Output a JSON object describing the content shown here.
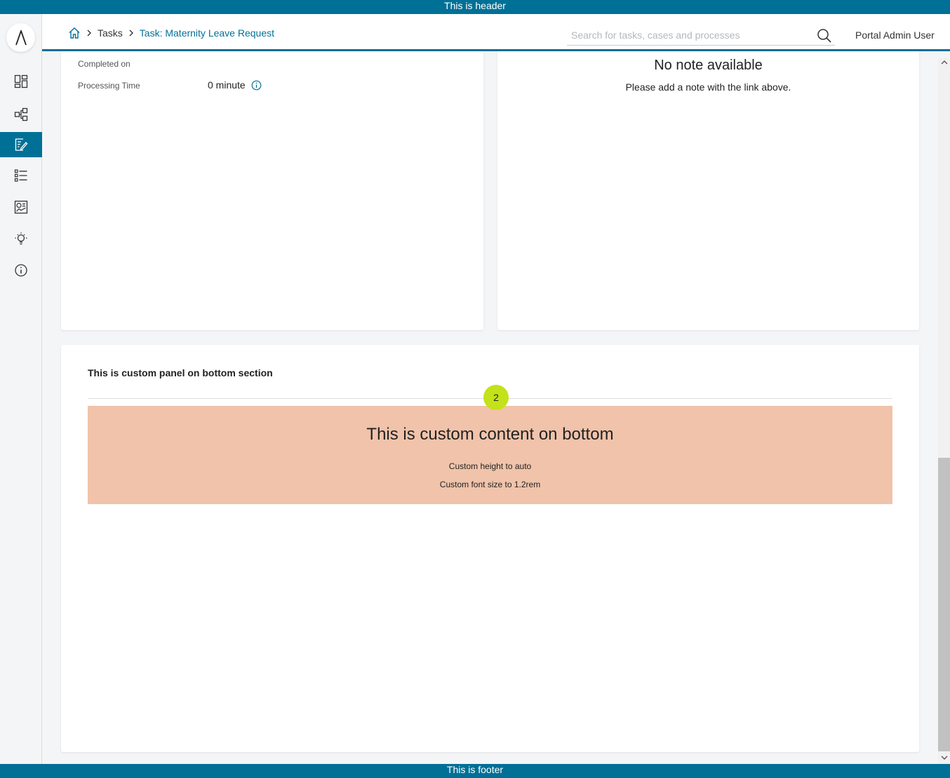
{
  "banners": {
    "header": "This is header",
    "footer": "This is footer"
  },
  "sidebar": {
    "logo": "Λ",
    "items": [
      {
        "name": "dashboard",
        "icon": "dashboard-icon"
      },
      {
        "name": "processes",
        "icon": "process-icon"
      },
      {
        "name": "tasks",
        "icon": "task-edit-icon",
        "active": true
      },
      {
        "name": "cases",
        "icon": "list-icon"
      },
      {
        "name": "statistics",
        "icon": "statistics-icon"
      },
      {
        "name": "ideas",
        "icon": "lightbulb-icon"
      },
      {
        "name": "about",
        "icon": "info-icon"
      }
    ]
  },
  "header": {
    "breadcrumb": {
      "home_icon": "home-icon",
      "items": [
        "Tasks",
        "Task: Maternity Leave Request"
      ]
    },
    "search": {
      "placeholder": "Search for tasks, cases and processes",
      "value": ""
    },
    "user": "Portal Admin User"
  },
  "task_details": {
    "completed_on_label": "Completed on",
    "completed_on_value": "",
    "processing_time_label": "Processing Time",
    "processing_time_value": "0 minute"
  },
  "notes": {
    "title": "No note available",
    "subtitle": "Please add a note with the link above."
  },
  "bottom_panel": {
    "title": "This is custom panel on bottom section",
    "badge": "2",
    "content_title": "This is custom content on bottom",
    "line1": "Custom height to auto",
    "line2": "Custom font size to 1.2rem"
  },
  "colors": {
    "primary": "#017097",
    "badge": "#c3e21a",
    "custom_box": "#f0c3aa"
  }
}
